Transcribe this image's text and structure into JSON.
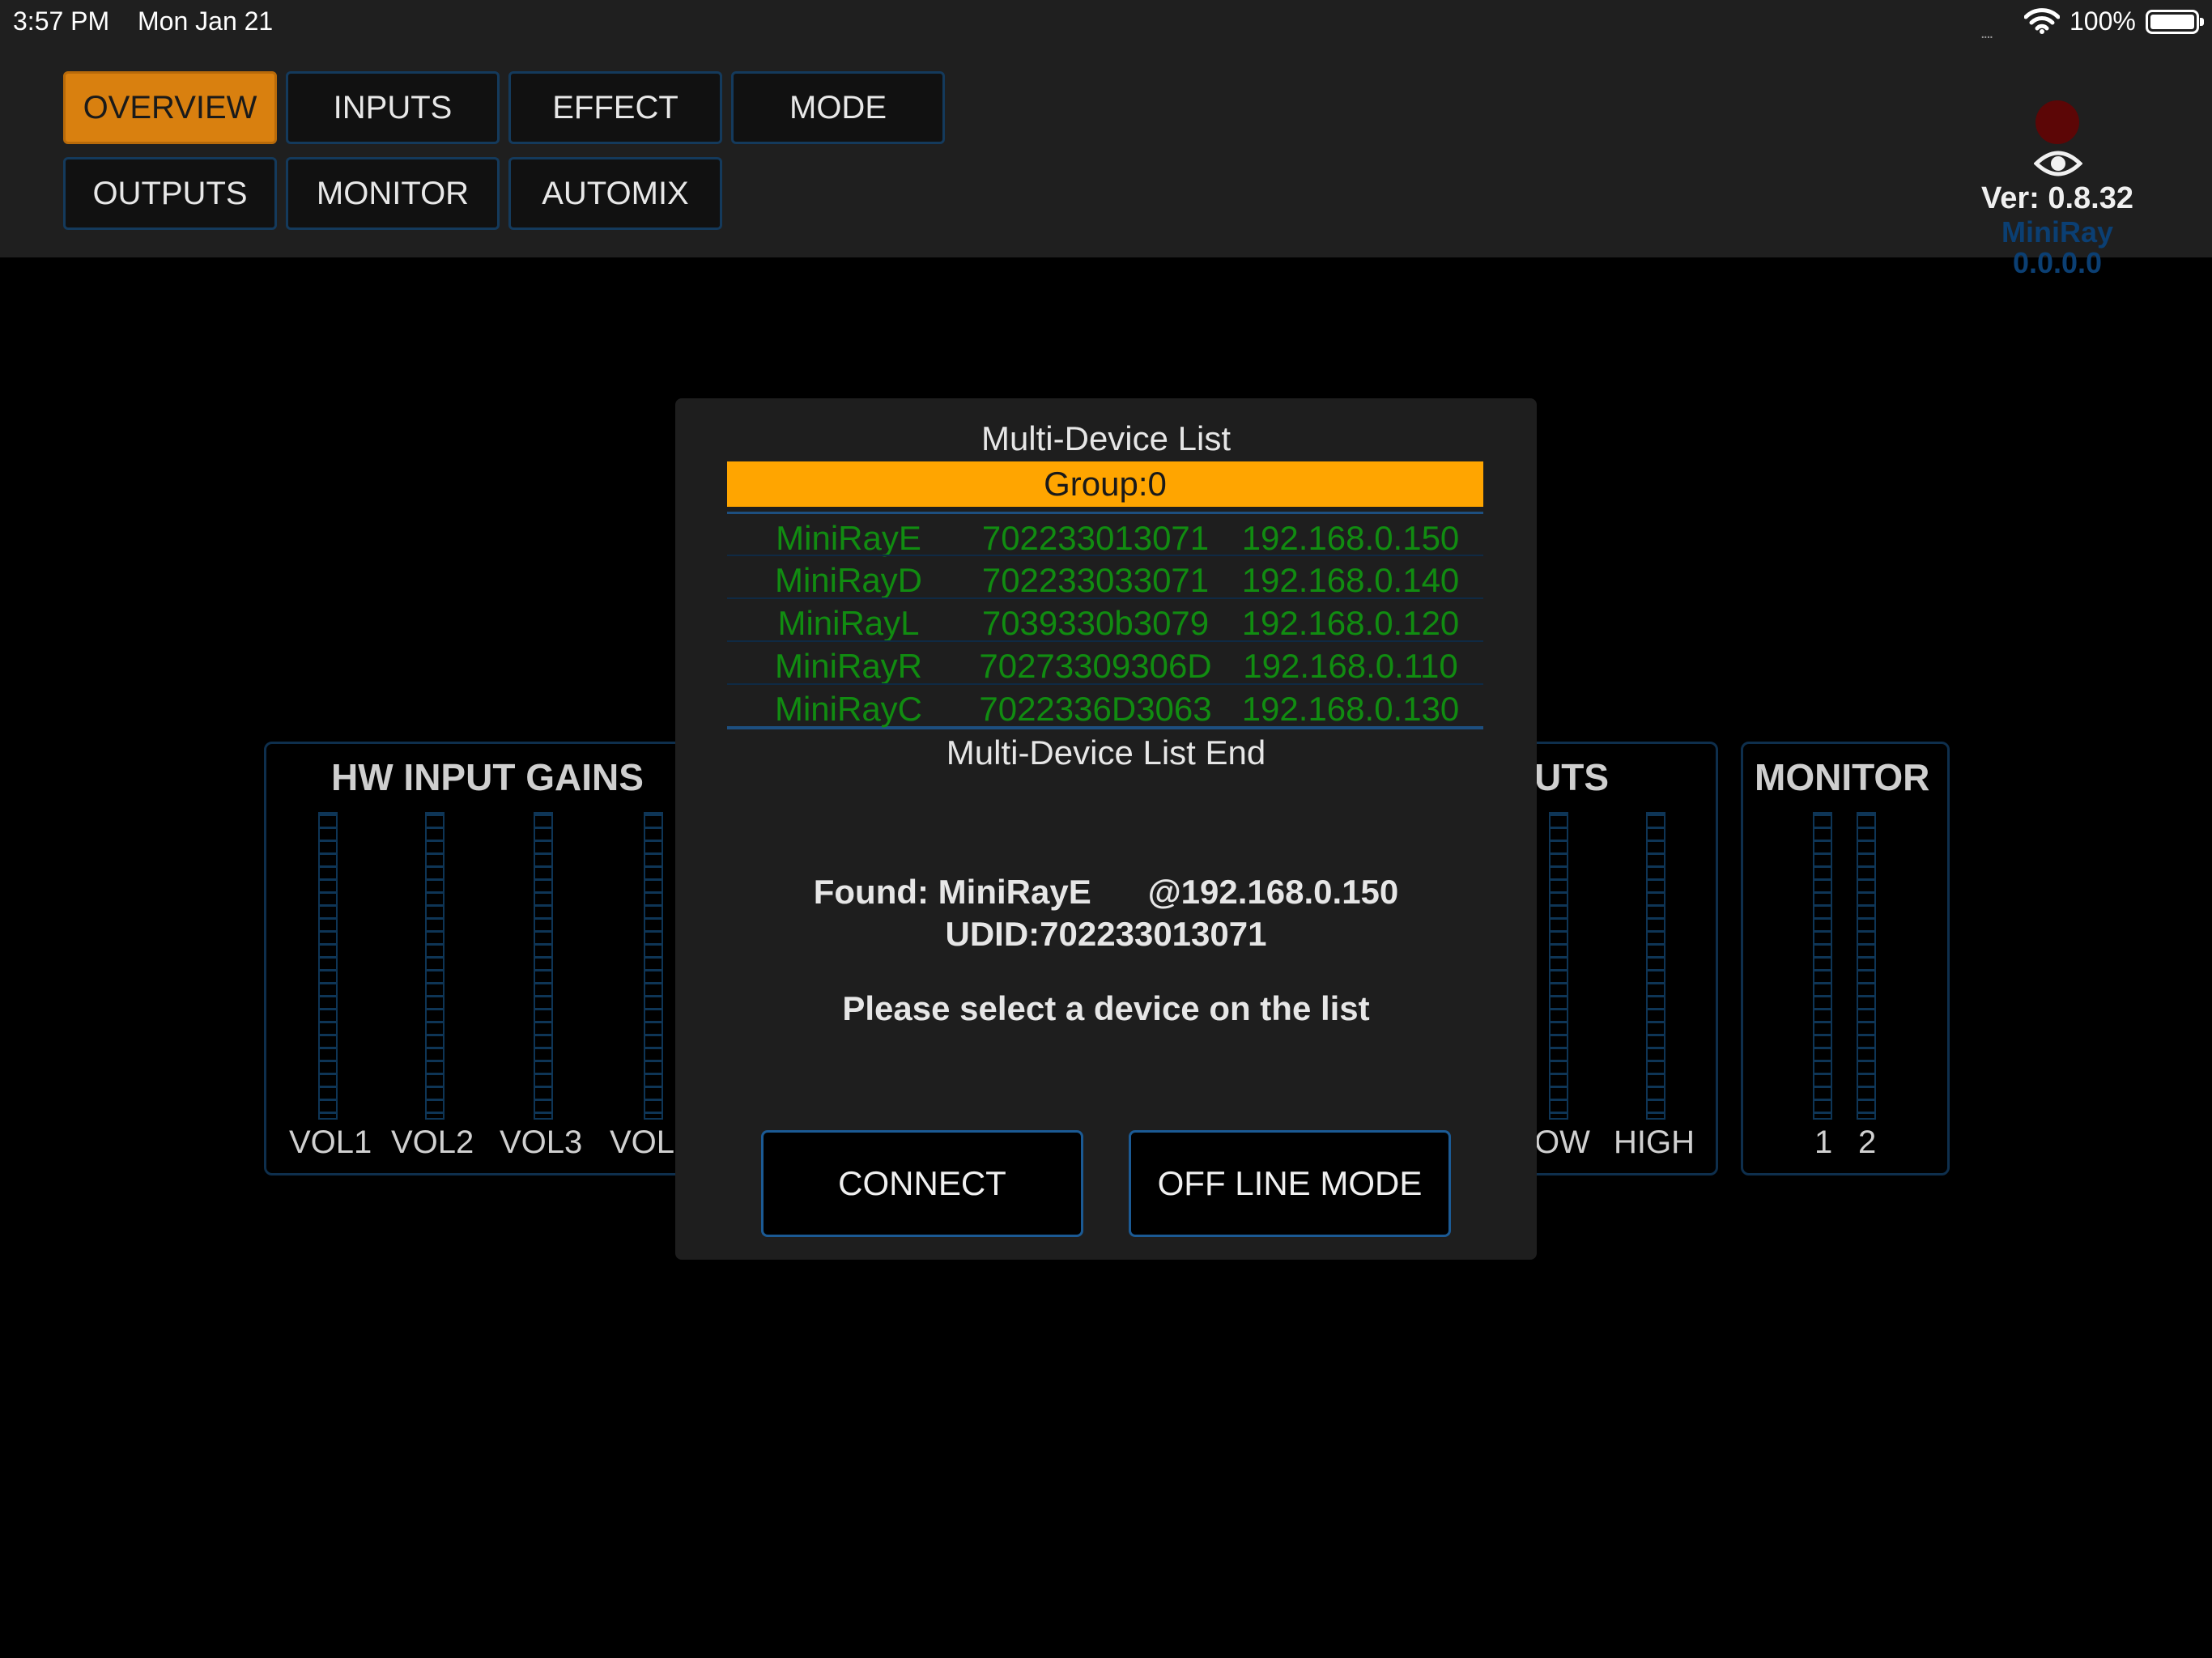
{
  "status_bar": {
    "time": "3:57 PM",
    "date": "Mon Jan 21",
    "signal": "....",
    "battery_pct": "100%"
  },
  "nav": {
    "row1": [
      "OVERVIEW",
      "INPUTS",
      "EFFECT",
      "MODE"
    ],
    "row2": [
      "OUTPUTS",
      "MONITOR",
      "AUTOMIX"
    ],
    "active": "OVERVIEW"
  },
  "header_right": {
    "version": "Ver: 0.8.32",
    "device_name": "MiniRay",
    "device_ip": "0.0.0.0"
  },
  "background": {
    "hw_gains": {
      "title": "HW INPUT GAINS",
      "labels": [
        "VOL1",
        "VOL2",
        "VOL3",
        "VOL"
      ]
    },
    "outputs": {
      "title": "UTS",
      "labels": [
        "OW",
        "HIGH"
      ]
    },
    "monitor": {
      "title": "MONITOR",
      "labels": [
        "1",
        "2"
      ]
    }
  },
  "modal": {
    "title": "Multi-Device List",
    "group": "Group:0",
    "devices": [
      {
        "name": "MiniRayE",
        "udid": "702233013071",
        "ip": "192.168.0.150"
      },
      {
        "name": "MiniRayD",
        "udid": "702233033071",
        "ip": "192.168.0.140"
      },
      {
        "name": "MiniRayL",
        "udid": "7039330b3079",
        "ip": "192.168.0.120"
      },
      {
        "name": "MiniRayR",
        "udid": "70273309306D",
        "ip": "192.168.0.110"
      },
      {
        "name": "MiniRayC",
        "udid": "7022336D3063",
        "ip": "192.168.0.130"
      }
    ],
    "list_end": "Multi-Device List End",
    "found_line": "Found: MiniRayE      @192.168.0.150",
    "udid_line": "UDID:702233013071",
    "hint": "Please select a device on the list",
    "connect_label": "CONNECT",
    "offline_label": "OFF LINE MODE"
  },
  "colors": {
    "accent_orange": "#d9800f",
    "group_bar": "#ffa500",
    "device_text": "#118c11",
    "border_blue": "#1b5a94",
    "status_dot": "#5c0606"
  }
}
